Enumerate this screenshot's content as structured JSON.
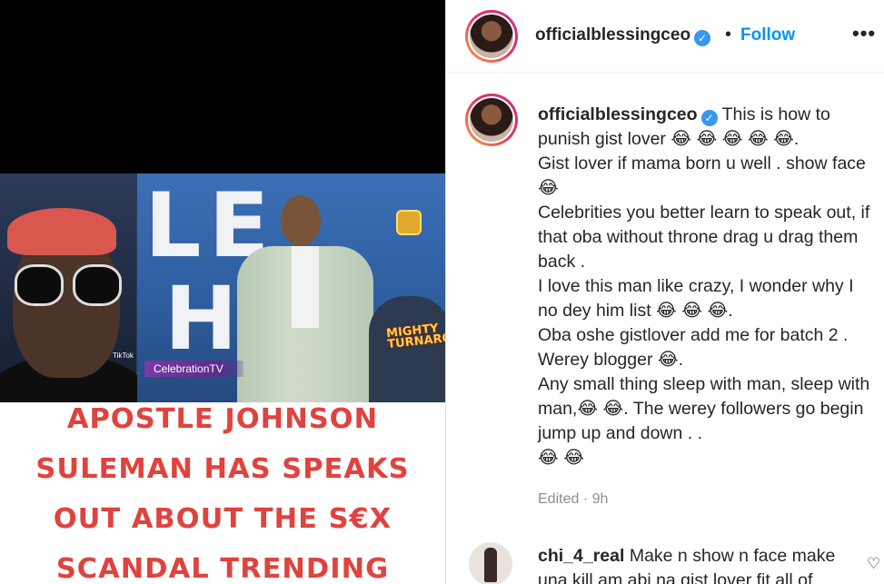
{
  "media": {
    "video_watermark": "CelebrationTV",
    "tiktok_mark": "TikTok",
    "stage_letters_top": "LE",
    "stage_letters_bottom": "H",
    "event_logo": "MIGHTY TURNAROUND",
    "headline_lines": [
      "APOSTLE JOHNSON",
      "SULEMAN HAS SPEAKS",
      "OUT ABOUT THE S€X",
      "SCANDAL TRENDING"
    ],
    "headline_color": "#e0433e"
  },
  "header": {
    "username": "officialblessingceo",
    "verified_icon": "verified-badge-icon",
    "separator": "•",
    "follow_label": "Follow",
    "more_label": "•••"
  },
  "caption": {
    "username": "officialblessingceo",
    "text": " This is how to punish gist lover 😂 😂 😂 😂 😂.\nGist lover if mama born u well . show face 😂\nCelebrities you better learn to speak out, if that oba without throne drag u drag them back .\nI love this man like crazy, I wonder why I no dey him list 😂 😂 😂.\nOba oshe gistlover add me for batch 2 . Werey blogger 😂.\nAny small thing sleep with man, sleep with man,😂 😂. The werey followers go begin jump up and down . .\n😂 😂",
    "edited": "Edited · 9h"
  },
  "comments": [
    {
      "username": "chi_4_real",
      "text": " Make n show n face make una kill am abi na gist lover fit all of"
    }
  ],
  "colors": {
    "accent": "#0095f6",
    "verified": "#3897f0",
    "muted": "#8e8e8e"
  }
}
